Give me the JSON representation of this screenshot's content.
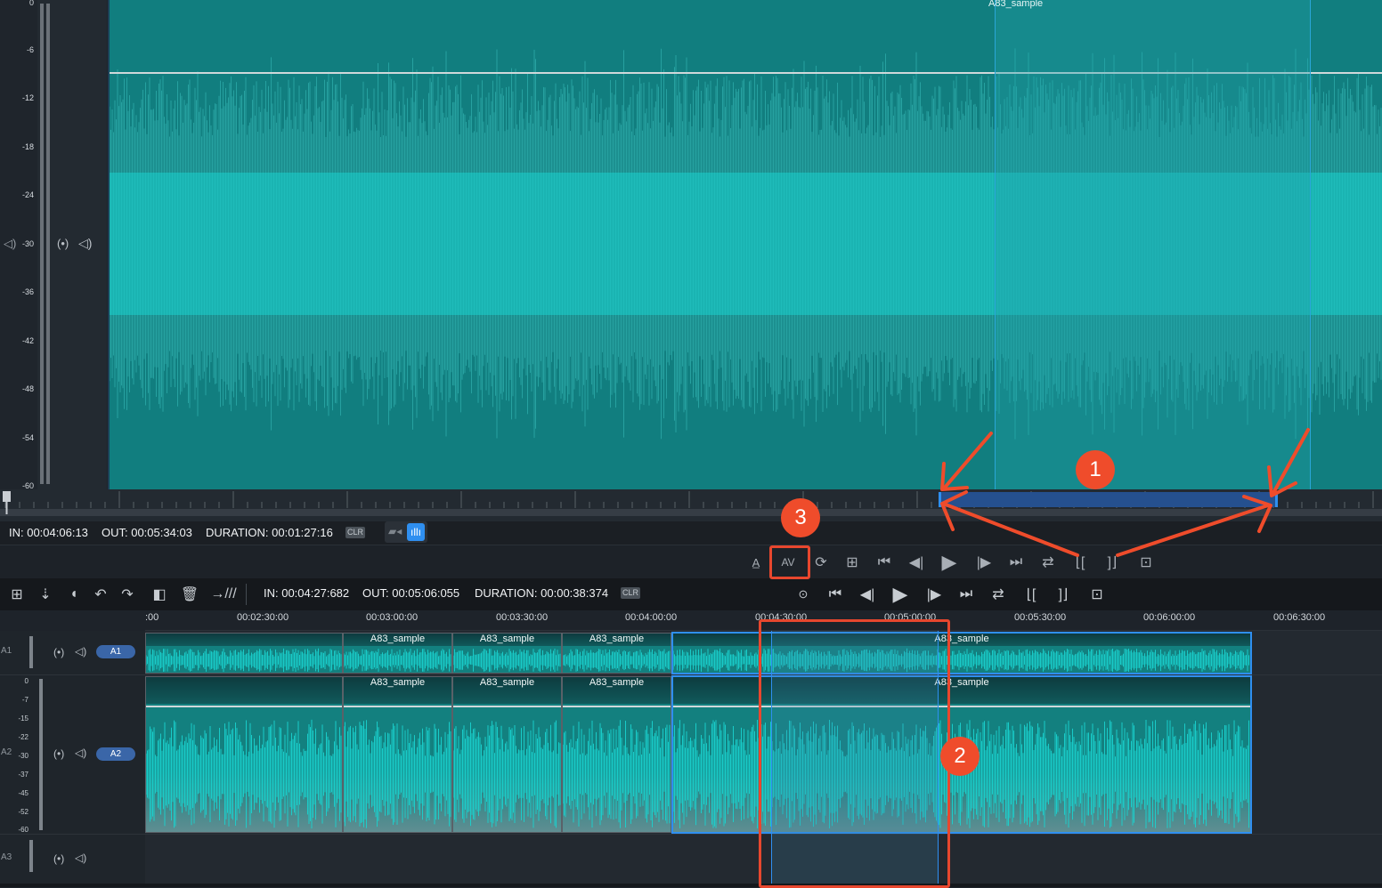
{
  "source_monitor": {
    "db_scale": [
      "0",
      "-6",
      "-12",
      "-18",
      "-24",
      "-30",
      "-36",
      "-42",
      "-48",
      "-54",
      "-60"
    ],
    "clip_name": "A83_sample",
    "in_label": "IN: 00:04:06:13",
    "out_label": "OUT: 00:05:34:03",
    "duration_label": "DURATION: 00:01:27:16",
    "clr": "CLR"
  },
  "timeline_toolbar": {
    "in_label": "IN: 00:04:27:682",
    "out_label": "OUT: 00:05:06:055",
    "duration_label": "DURATION: 00:00:38:374",
    "clr": "CLR",
    "av_label": "AV"
  },
  "timeline": {
    "ruler": [
      ":00",
      "00:02:30:00",
      "00:03:00:00",
      "00:03:30:00",
      "00:04:00:00",
      "00:04:30:00",
      "00:05:00:00",
      "00:05:30:00",
      "00:06:00:00",
      "00:06:30:00"
    ],
    "tracks": [
      {
        "id": "A1",
        "pill": "A1",
        "clips": [
          "",
          "A83_sample",
          "A83_sample",
          "A83_sample",
          "A83_sample"
        ]
      },
      {
        "id": "A2",
        "pill": "A2",
        "db_scale": [
          "0",
          "-7",
          "-15",
          "-22",
          "-30",
          "-37",
          "-45",
          "-52",
          "-60"
        ],
        "clips": [
          "",
          "A83_sample",
          "A83_sample",
          "A83_sample",
          "A83_sample"
        ]
      },
      {
        "id": "A3",
        "pill": "",
        "clips": []
      }
    ]
  },
  "annotations": {
    "badges": [
      "1",
      "2",
      "3"
    ],
    "color": "#ef4c2b"
  },
  "colors": {
    "waveform": "#1ad4d0",
    "clip_bg": "#13807f",
    "selection": "#2f8ff0",
    "pill": "#3a66a8"
  }
}
